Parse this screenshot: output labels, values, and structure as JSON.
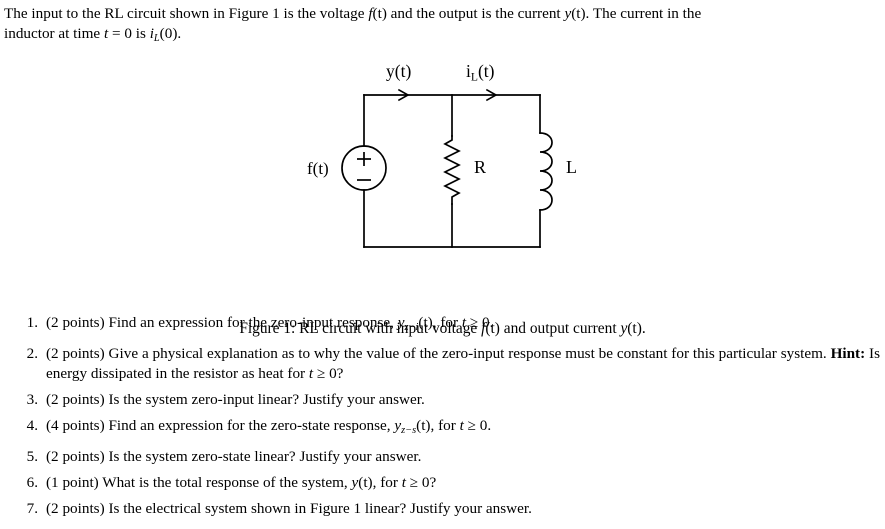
{
  "intro": {
    "line1_a": "The input to the RL circuit shown in Figure 1 is the voltage ",
    "line1_f": "f",
    "line1_b": "(t) and the output is the current ",
    "line1_y": "y",
    "line1_c": "(t).  The current in the",
    "line2_a": "inductor at time ",
    "line2_t": "t",
    "line2_b": " = 0 is ",
    "line2_i": "i",
    "line2_sub": "L",
    "line2_c": "(0)."
  },
  "figure": {
    "label_yt": "y(t)",
    "label_il_main": "i",
    "label_il_sub": "L",
    "label_il_tail": "(t)",
    "label_ft": "f(t)",
    "label_R": "R",
    "label_L": "L",
    "source_plus": "+",
    "source_minus": "−",
    "caption_a": "Figure 1: RL circuit with input voltage ",
    "caption_f": "f",
    "caption_b": "(t) and output current ",
    "caption_y": "y",
    "caption_c": "(t).",
    "colors": {
      "wire": "#000000",
      "text": "#000000",
      "background": "#ffffff"
    }
  },
  "questions": [
    {
      "number": "1.",
      "points": "(2 points)",
      "text_a": " Find an expression for the zero-input response, ",
      "sym_main": "y",
      "sym_sub": "z−i",
      "text_b": "(t), for ",
      "sym_t": "t",
      "text_c": " ≥ 0."
    },
    {
      "number": "2.",
      "points": "(2 points)",
      "text_a": " Give a physical explanation as to why the value of the zero-input response must be constant for this particular system. ",
      "hint": "Hint:",
      "text_b": " Is energy dissipated in the resistor as heat for ",
      "sym_t": "t",
      "text_c": " ≥ 0?"
    },
    {
      "number": "3.",
      "points": "(2 points)",
      "text_a": " Is the system zero-input linear? Justify your answer."
    },
    {
      "number": "4.",
      "points": "(4 points)",
      "text_a": " Find an expression for the zero-state response, ",
      "sym_main": "y",
      "sym_sub": "z−s",
      "text_b": "(t), for ",
      "sym_t": "t",
      "text_c": " ≥ 0."
    },
    {
      "number": "5.",
      "points": "(2 points)",
      "text_a": " Is the system zero-state linear? Justify your answer."
    },
    {
      "number": "6.",
      "points": "(1 point)",
      "text_a": " What is the total response of the system, ",
      "sym_main": "y",
      "text_b": "(t), for ",
      "sym_t": "t",
      "text_c": " ≥ 0?"
    },
    {
      "number": "7.",
      "points": "(2 points)",
      "text_a": " Is the electrical system shown in Figure 1 linear? Justify your answer."
    }
  ]
}
